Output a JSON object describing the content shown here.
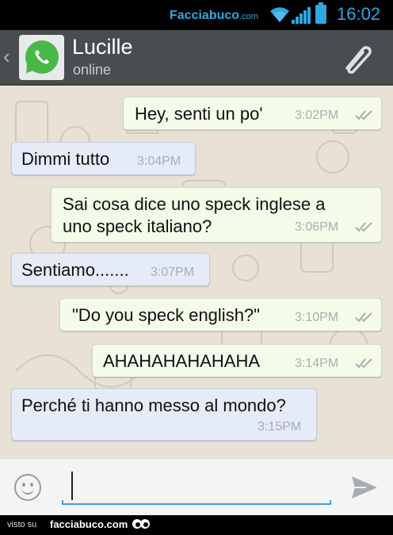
{
  "status_bar": {
    "brand": "Facciabuco",
    "brand_suffix": ".com",
    "time": "16:02"
  },
  "header": {
    "contact_name": "Lucille",
    "contact_status": "online"
  },
  "messages": [
    {
      "direction": "outgoing",
      "text": "Hey, senti un po'",
      "time": "3:02PM",
      "read": true
    },
    {
      "direction": "incoming",
      "text": "Dimmi tutto",
      "time": "3:04PM"
    },
    {
      "direction": "outgoing",
      "text_lines": [
        "Sai cosa dice uno speck inglese a",
        "uno speck italiano?"
      ],
      "time": "3:06PM",
      "read": true
    },
    {
      "direction": "incoming",
      "text": "Sentiamo.......",
      "time": "3:07PM"
    },
    {
      "direction": "outgoing",
      "text": "\"Do you speck english?\"",
      "time": "3:10PM",
      "read": true
    },
    {
      "direction": "outgoing",
      "text": "AHAHAHAHAHAHA",
      "time": "3:14PM",
      "read": true
    },
    {
      "direction": "incoming",
      "text": "Perché ti hanno messo al mondo?",
      "time": "3:15PM"
    }
  ],
  "input": {
    "value": "",
    "placeholder": ""
  },
  "footer": {
    "prefix": "visto su",
    "site": "facciabuco.com"
  },
  "colors": {
    "header_bg": "#4a4d4f",
    "chat_bg": "#e9e1d5",
    "outgoing_bubble": "#f4fbe8",
    "incoming_bubble": "#e5ebf7",
    "accent": "#2fa7e0",
    "whatsapp_green": "#49b847"
  },
  "icons": [
    "wifi-icon",
    "signal-icon",
    "battery-icon",
    "back-chevron-icon",
    "whatsapp-logo-icon",
    "paperclip-icon",
    "double-check-icon",
    "emoji-icon",
    "send-icon",
    "eyes-icon"
  ]
}
